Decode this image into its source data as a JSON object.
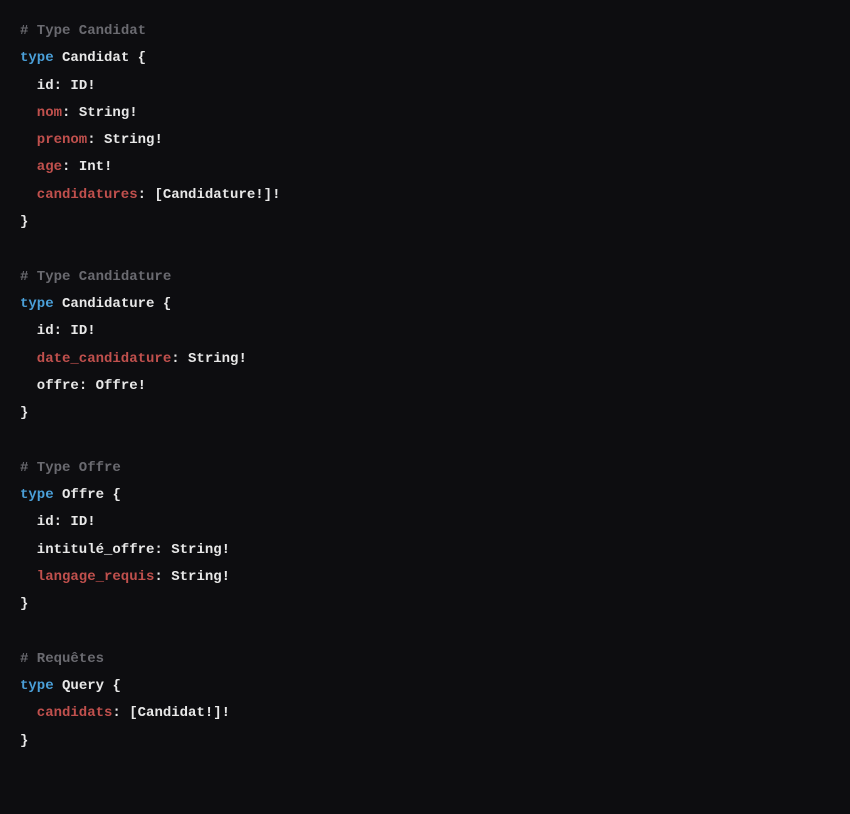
{
  "blocks": [
    {
      "comment": "# Type Candidat",
      "keyword": "type",
      "name": "Candidat",
      "fields": [
        {
          "name": "id",
          "style": "white",
          "ret": "ID!"
        },
        {
          "name": "nom",
          "style": "red",
          "ret": "String!"
        },
        {
          "name": "prenom",
          "style": "red",
          "ret": "String!"
        },
        {
          "name": "age",
          "style": "red",
          "ret": "Int!"
        },
        {
          "name": "candidatures",
          "style": "red",
          "ret": "[Candidature!]!"
        }
      ]
    },
    {
      "comment": "# Type Candidature",
      "keyword": "type",
      "name": "Candidature",
      "fields": [
        {
          "name": "id",
          "style": "white",
          "ret": "ID!"
        },
        {
          "name": "date_candidature",
          "style": "red",
          "ret": "String!"
        },
        {
          "name": "offre",
          "style": "white",
          "ret": "Offre!"
        }
      ]
    },
    {
      "comment": "# Type Offre",
      "keyword": "type",
      "name": "Offre",
      "fields": [
        {
          "name": "id",
          "style": "white",
          "ret": "ID!"
        },
        {
          "name": "intitulé_offre",
          "style": "white",
          "ret": "String!"
        },
        {
          "name": "langage_requis",
          "style": "red",
          "ret": "String!"
        }
      ]
    },
    {
      "comment": "# Requêtes",
      "keyword": "type",
      "name": "Query",
      "fields": [
        {
          "name": "candidats",
          "style": "red",
          "ret": "[Candidat!]!"
        }
      ]
    }
  ]
}
